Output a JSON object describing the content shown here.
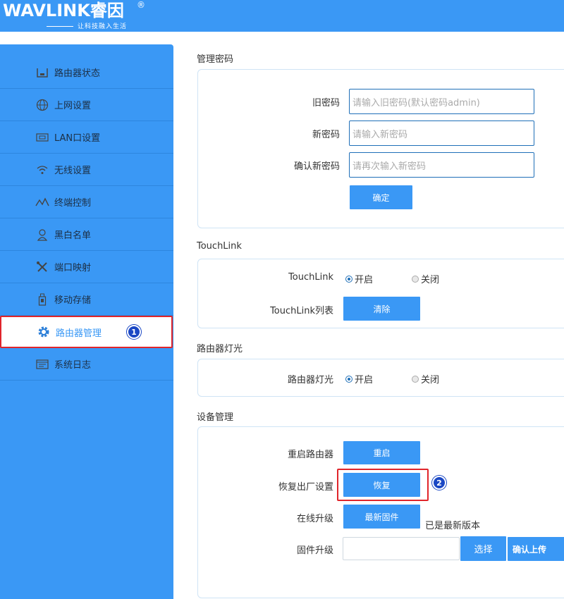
{
  "brand": {
    "logo_text": "WAVLINK睿因",
    "registered": "®",
    "slogan": "让科技融入生活"
  },
  "colors": {
    "accent": "#3a98f5",
    "highlight": "#e0252b",
    "badge": "#1a47c4"
  },
  "sidebar": {
    "items": [
      {
        "label": "路由器状态",
        "icon": "router-status-icon"
      },
      {
        "label": "上网设置",
        "icon": "globe-icon"
      },
      {
        "label": "LAN口设置",
        "icon": "lan-port-icon"
      },
      {
        "label": "无线设置",
        "icon": "wifi-icon"
      },
      {
        "label": "终端控制",
        "icon": "terminal-control-icon"
      },
      {
        "label": "黑白名单",
        "icon": "user-list-icon"
      },
      {
        "label": "端口映射",
        "icon": "tools-icon"
      },
      {
        "label": "移动存储",
        "icon": "usb-storage-icon"
      },
      {
        "label": "路由器管理",
        "icon": "gear-icon",
        "active": true
      },
      {
        "label": "系统日志",
        "icon": "log-icon"
      }
    ],
    "step_badge": "1"
  },
  "password": {
    "title": "管理密码",
    "old_label": "旧密码",
    "old_placeholder": "请输入旧密码(默认密码admin)",
    "new_label": "新密码",
    "new_placeholder": "请输入新密码",
    "confirm_label": "确认新密码",
    "confirm_placeholder": "请再次输入新密码",
    "submit": "确定"
  },
  "touchlink": {
    "title": "TouchLink",
    "label": "TouchLink",
    "on": "开启",
    "off": "关闭",
    "list_label": "TouchLink列表",
    "clear": "清除"
  },
  "light": {
    "title": "路由器灯光",
    "label": "路由器灯光",
    "on": "开启",
    "off": "关闭"
  },
  "device": {
    "title": "设备管理",
    "reboot_label": "重启路由器",
    "reboot_btn": "重启",
    "reset_label": "恢复出厂设置",
    "reset_btn": "恢复",
    "step_badge": "2",
    "upgrade_label": "在线升级",
    "upgrade_btn": "最新固件",
    "upgrade_status": "已是最新版本",
    "firmware_label": "固件升级",
    "choose_btn": "选择",
    "upload_btn": "确认上传"
  }
}
